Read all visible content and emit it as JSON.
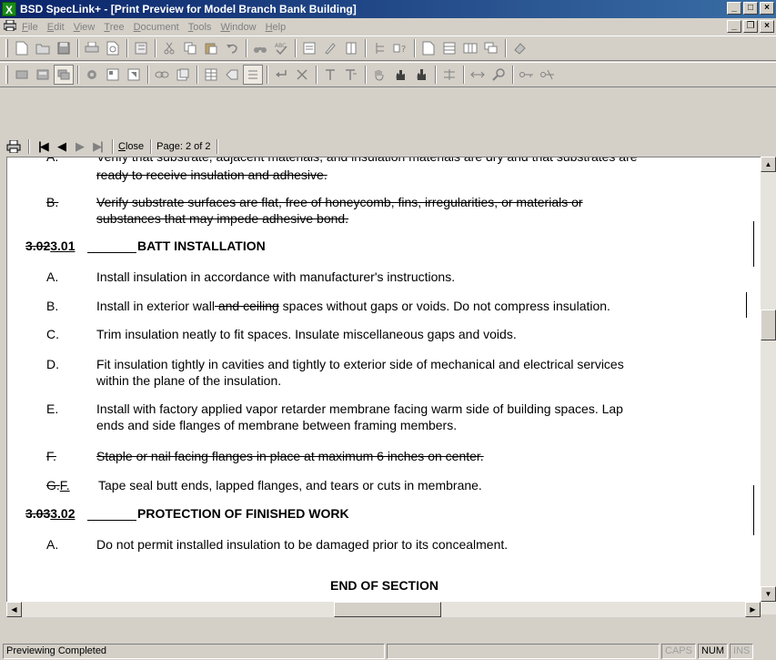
{
  "window": {
    "title": "BSD SpecLink+ - [Print Preview for Model Branch Bank Building]",
    "app_icon": "X",
    "min_glyph": "_",
    "max_glyph": "□",
    "close_glyph": "×",
    "restore_glyph": "❐"
  },
  "menu": {
    "items": [
      {
        "u": "F",
        "rest": "ile"
      },
      {
        "u": "E",
        "rest": "dit"
      },
      {
        "u": "V",
        "rest": "iew"
      },
      {
        "u": "T",
        "rest": "ree"
      },
      {
        "u": "D",
        "rest": "ocument"
      },
      {
        "u": "T",
        "rest": "ools"
      },
      {
        "u": "W",
        "rest": "indow"
      },
      {
        "u": "H",
        "rest": "elp"
      }
    ]
  },
  "preview_bar": {
    "close_u": "C",
    "close_rest": "lose",
    "page_label": "Page: 2 of 2",
    "first_glyph": "|◀",
    "prev_glyph": "◀",
    "next_glyph": "▶",
    "last_glyph": "▶|"
  },
  "document": {
    "top_partial_1": "Verify that substrate, adjacent materials, and insulation materials are dry and that substrates are",
    "top_partial_2": "ready to receive insulation and adhesive.",
    "item_b_letter": "B.",
    "item_b_line1": "Verify substrate surfaces are flat, free of honeycomb, fins, irregularities, or materials or",
    "item_b_line2": "substances that may impede adhesive bond.",
    "sec1_old": "3.02",
    "sec1_new": "3.01",
    "sec1_title": "BATT INSTALLATION",
    "a_letter": "A.",
    "a_text": "Install insulation in accordance with manufacturer's  instructions.",
    "b_letter": "B.",
    "b_text_1": "Install in exterior wall",
    "b_text_del": " and ceiling",
    "b_text_2": " spaces without gaps or voids.  Do not compress insulation.",
    "c_letter": "C.",
    "c_text": "Trim insulation neatly to fit spaces.  Insulate miscellaneous gaps and voids.",
    "d_letter": "D.",
    "d_line1": "Fit insulation tightly in cavities and tightly to exterior side of mechanical and electrical services",
    "d_line2": "within the plane of the insulation.",
    "e_letter": "E.",
    "e_line1": "Install with factory applied vapor retarder membrane facing warm side of building spaces.  Lap",
    "e_line2": "ends and side flanges of membrane between framing members.",
    "f_letter": "F.",
    "f_text": "Staple or nail facing flanges in place at maximum 6 inches on center.",
    "g_old": "G.",
    "g_new": "F.",
    "g_text": "Tape seal butt ends, lapped flanges, and tears or cuts in membrane.",
    "sec2_old": "3.03",
    "sec2_new": "3.02",
    "sec2_title": "PROTECTION OF FINISHED WORK",
    "pa_letter": "A.",
    "pa_text": "Do not permit installed insulation to be damaged prior to its concealment.",
    "end": "END OF SECTION"
  },
  "status": {
    "message": "Previewing Completed",
    "caps": "CAPS",
    "num": "NUM",
    "ins": "INS"
  },
  "colors": {
    "title_start": "#0a246a",
    "title_end": "#3a6ea5",
    "chrome": "#d4d0c8",
    "paper": "#ffffff"
  }
}
